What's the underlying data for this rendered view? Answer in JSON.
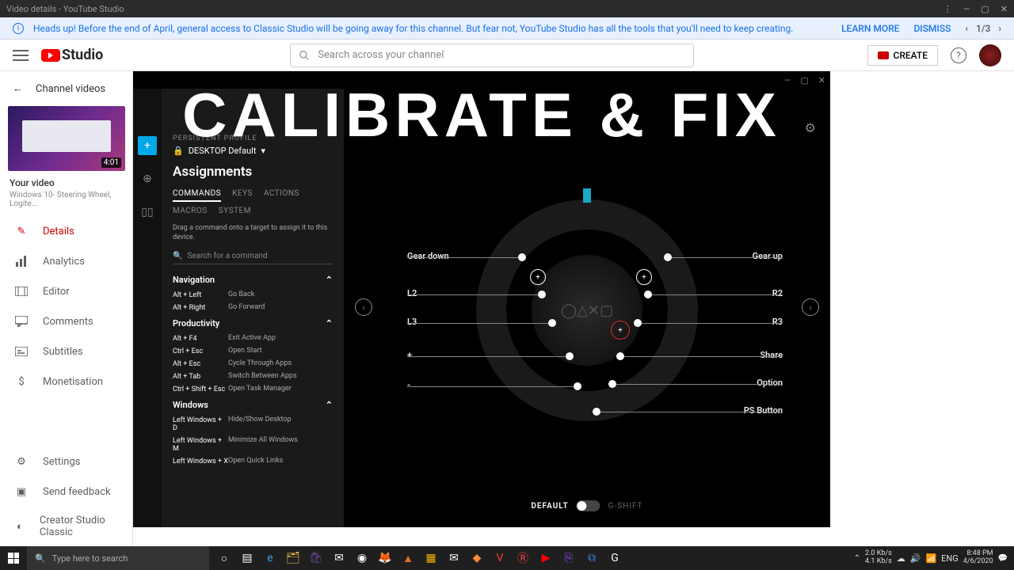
{
  "window": {
    "title": "Video details - YouTube Studio"
  },
  "banner": {
    "message": "Heads up! Before the end of April, general access to Classic Studio will be going away for this channel. But fear not, YouTube Studio has all the tools that you'll need to keep creating.",
    "learn_more": "LEARN MORE",
    "dismiss": "DISMISS",
    "page_indicator": "1/3"
  },
  "header": {
    "logo_text": "Studio",
    "search_placeholder": "Search across your channel",
    "create_label": "CREATE"
  },
  "sidebar": {
    "back_label": "Channel videos",
    "thumb_duration": "4:01",
    "video_label": "Your video",
    "video_subtitle": "Windows 10- Steering Wheel, Logite...",
    "items": [
      {
        "label": "Details",
        "active": true
      },
      {
        "label": "Analytics"
      },
      {
        "label": "Editor"
      },
      {
        "label": "Comments"
      },
      {
        "label": "Subtitles"
      },
      {
        "label": "Monetisation"
      }
    ],
    "footer": [
      {
        "label": "Settings"
      },
      {
        "label": "Send feedback"
      },
      {
        "label": "Creator Studio Classic"
      }
    ]
  },
  "ghub": {
    "overlay_text": "CALIBRATE & FIX",
    "profile_header": "PERSISTENT PROFILE",
    "profile_name": "DESKTOP Default",
    "panel_title": "Assignments",
    "tabs": [
      "COMMANDS",
      "KEYS",
      "ACTIONS",
      "MACROS",
      "SYSTEM"
    ],
    "hint": "Drag a command onto a target to assign it to this device.",
    "search_placeholder": "Search for a command",
    "sections": {
      "navigation": {
        "title": "Navigation",
        "rows": [
          {
            "key": "Alt + Left",
            "desc": "Go Back"
          },
          {
            "key": "Alt + Right",
            "desc": "Go Forward"
          }
        ]
      },
      "productivity": {
        "title": "Productivity",
        "rows": [
          {
            "key": "Alt + F4",
            "desc": "Exit Active App"
          },
          {
            "key": "Ctrl + Esc",
            "desc": "Open Start"
          },
          {
            "key": "Alt + Esc",
            "desc": "Cycle Through Apps"
          },
          {
            "key": "Alt + Tab",
            "desc": "Switch Between Apps"
          },
          {
            "key": "Ctrl + Shift + Esc",
            "desc": "Open Task Manager"
          }
        ]
      },
      "windows": {
        "title": "Windows",
        "rows": [
          {
            "key": "Left Windows + D",
            "desc": "Hide/Show Desktop"
          },
          {
            "key": "Left Windows + M",
            "desc": "Minimize All Windows"
          },
          {
            "key": "Left Windows + X",
            "desc": "Open Quick Links"
          }
        ]
      }
    },
    "wheel_labels": {
      "gear_down": "Gear down",
      "gear_up": "Gear up",
      "l2": "L2",
      "r2": "R2",
      "l3": "L3",
      "r3": "R3",
      "plus": "+",
      "minus": "-",
      "share": "Share",
      "option": "Option",
      "ps": "PS Button"
    },
    "mode_default": "DEFAULT",
    "mode_gshift": "G-SHIFT"
  },
  "taskbar": {
    "search_placeholder": "Type here to search",
    "net_up": "2.0 Kb/s",
    "net_down": "4.1 Kb/s",
    "time": "8:48 PM",
    "date": "4/6/2020"
  }
}
